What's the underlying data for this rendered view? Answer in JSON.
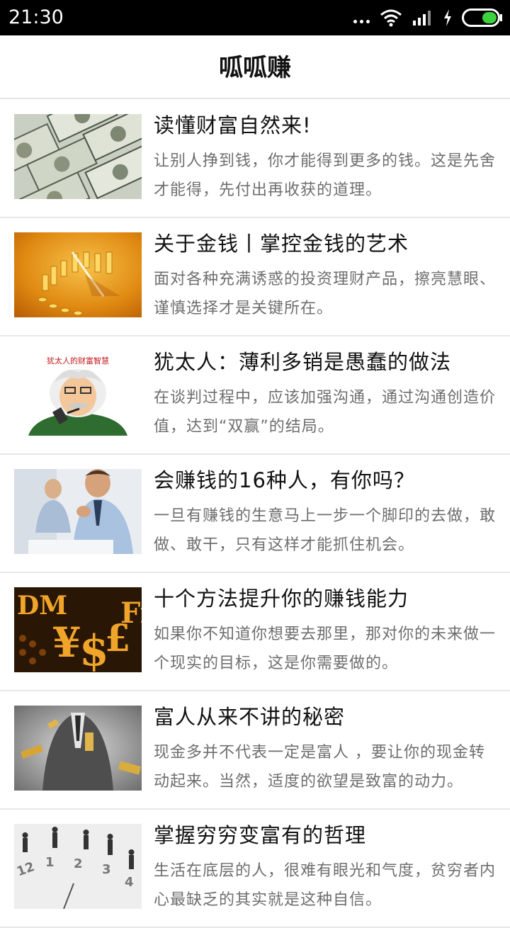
{
  "status_bar": {
    "time": "21:30",
    "icons": [
      "more-dots-icon",
      "wifi-icon",
      "signal-icon",
      "charging-icon",
      "battery-icon"
    ]
  },
  "header": {
    "title": "呱呱赚"
  },
  "articles": [
    {
      "title": "读懂财富自然来!",
      "desc": "让别人挣到钱，你才能得到更多的钱。这是先舍才能得，先付出再收获的道理。",
      "thumbnail": "dollar-bills-image"
    },
    {
      "title": "关于金钱丨掌控金钱的艺术",
      "desc": "面对各种充满诱惑的投资理财产品，擦亮慧眼、谨慎选择才是关键所在。",
      "thumbnail": "gold-coin-clock-image"
    },
    {
      "title": "犹太人：薄利多销是愚蠢的做法",
      "desc": "在谈判过程中，应该加强沟通，通过沟通创造价值，达到“双赢”的结局。",
      "thumbnail": "jewish-wealth-cartoon-image",
      "thumbnail_caption": "犹太人的财富智慧"
    },
    {
      "title": "会赚钱的16种人，有你吗？",
      "desc": "一旦有赚钱的生意马上一步一个脚印的去做，敢做、敢干，只有这样才能抓住机会。",
      "thumbnail": "office-men-image"
    },
    {
      "title": "十个方法提升你的赚钱能力",
      "desc": "如果你不知道你想要去那里，那对你的未来做一个现实的目标，这是你需要做的。",
      "thumbnail": "currency-symbols-image"
    },
    {
      "title": "富人从来不讲的秘密",
      "desc": "现金多并不代表一定是富人 ，要让你的现金转动起来。当然，适度的欲望是致富的动力。",
      "thumbnail": "businessman-gold-bars-image"
    },
    {
      "title": "掌握穷穷变富有的哲理",
      "desc": "生活在底层的人，很难有眼光和气度，贫穷者内心最缺乏的其实就是这种自信。",
      "thumbnail": "clock-figures-image"
    }
  ]
}
